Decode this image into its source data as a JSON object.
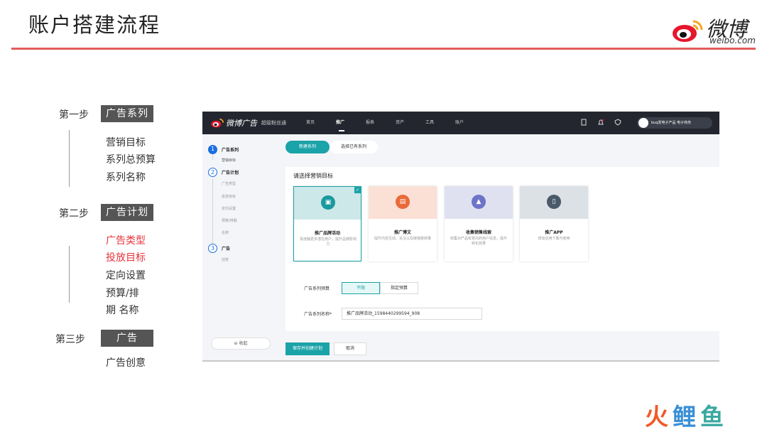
{
  "slide": {
    "title": "账户搭建流程",
    "logo_cn": "微博",
    "logo_en": "weibo.com",
    "watermark": [
      "火",
      "鲤",
      "鱼"
    ]
  },
  "steps": [
    {
      "label": "第一步",
      "chip": "广告系列",
      "items": [
        {
          "text": "营销目标",
          "highlight": false
        },
        {
          "text": "系列总预算",
          "highlight": false
        },
        {
          "text": "系列名称",
          "highlight": false
        }
      ]
    },
    {
      "label": "第二步",
      "chip": "广告计划",
      "items": [
        {
          "text": "广告类型",
          "highlight": true
        },
        {
          "text": "投放目标",
          "highlight": true
        },
        {
          "text": "定向设置",
          "highlight": false
        },
        {
          "text": "预算/排",
          "highlight": false
        },
        {
          "text": "期 名称",
          "highlight": false
        }
      ]
    },
    {
      "label": "第三步",
      "chip": "广告",
      "items": [
        {
          "text": "广告创意",
          "highlight": false
        }
      ]
    }
  ],
  "app": {
    "brand": "微博广告",
    "subbrand": "超级粉丝通",
    "nav": [
      "首页",
      "推广",
      "报表",
      "资产",
      "工具",
      "账户"
    ],
    "active_nav": "推广",
    "icons": [
      "document-icon",
      "bell-icon",
      "shield-icon"
    ],
    "user_name": "buq发电子产品 电子商务",
    "sidebar": {
      "steps": [
        {
          "num": "1",
          "label": "广告系列",
          "subs": [
            "营销目标"
          ]
        },
        {
          "num": "2",
          "label": "广告计划",
          "subs": [
            "广告类型",
            "投放目标",
            "定向设置",
            "预算/排期",
            "名称"
          ]
        },
        {
          "num": "3",
          "label": "广告",
          "subs": [
            "创意"
          ]
        }
      ],
      "collapse": "收起"
    },
    "tabs": {
      "new": "新建系列",
      "existing": "选择已有系列"
    },
    "section_title": "请选择营销目标",
    "goals": [
      {
        "title": "推广品牌活动",
        "desc": "投放触更多潜在用户，提升品牌影响力",
        "color": "#cde8e8",
        "icon_color": "#1a9a9e",
        "selected": true
      },
      {
        "title": "推广博文",
        "desc": "提升内容互动、关注以及链接跳转量",
        "color": "#fbe0d6",
        "icon_color": "#ea6a3a",
        "selected": false
      },
      {
        "title": "收集销售线索",
        "desc": "收集对产品有意向的用户信息，提升转化效果",
        "color": "#dfe1f1",
        "icon_color": "#6d74c8",
        "selected": false
      },
      {
        "title": "推广APP",
        "desc": "增加应用下载与使用",
        "color": "#dce1e6",
        "icon_color": "#4a5a6a",
        "selected": false
      }
    ],
    "budget_label": "广告系列预算",
    "budget_options": [
      "不限",
      "指定预算"
    ],
    "budget_selected": "不限",
    "name_label": "广告系列名称*",
    "name_value": "推广品牌活动_1598440299594_908",
    "save_button": "保存并创建计划",
    "cancel_button": "取消"
  }
}
